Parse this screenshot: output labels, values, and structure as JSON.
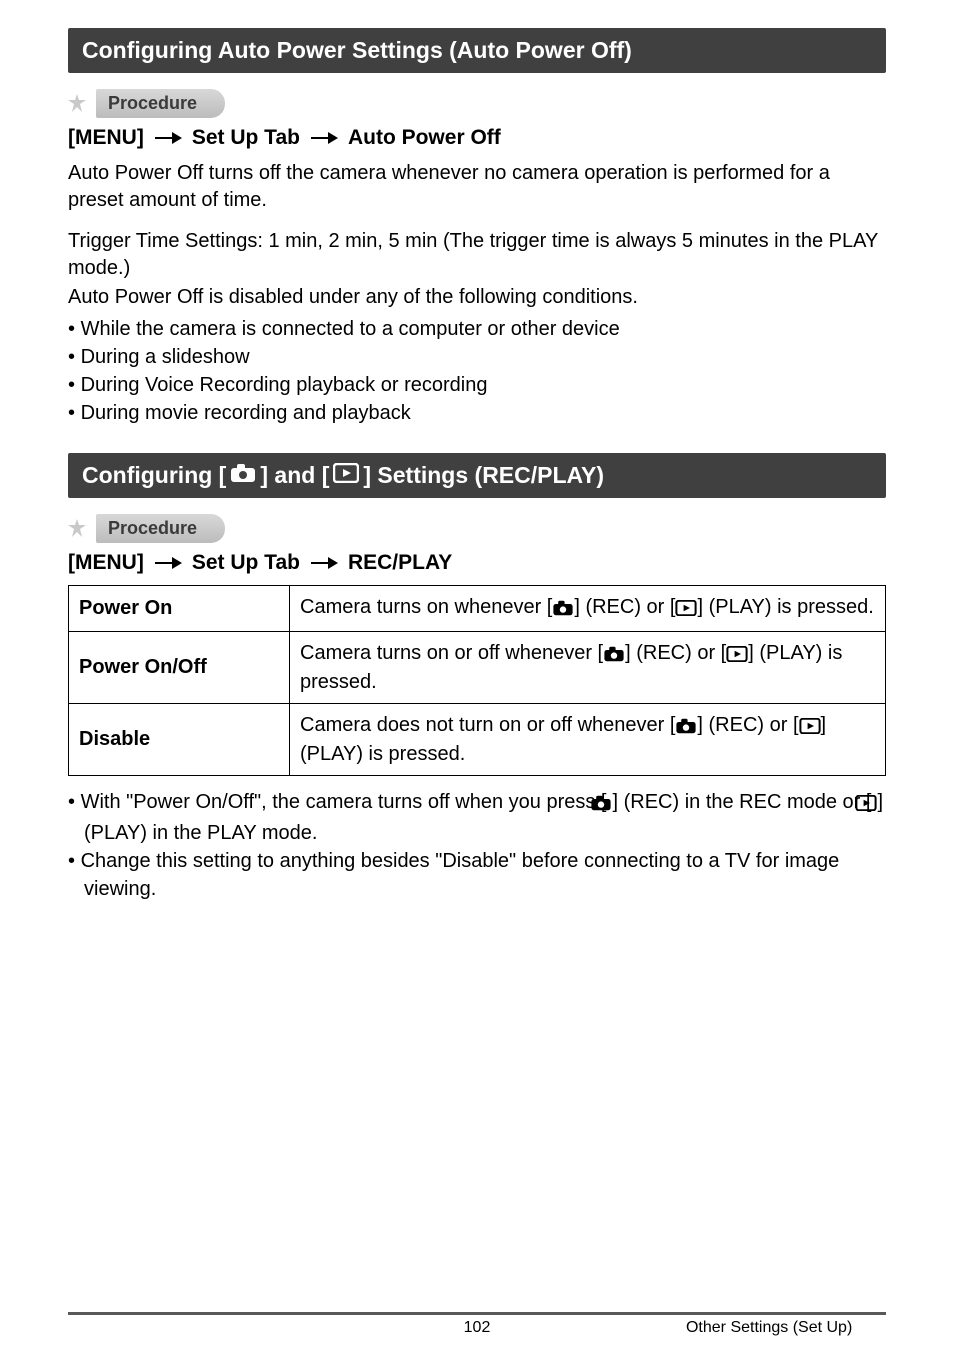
{
  "sections": {
    "autoPowerOff": {
      "title": "Configuring Auto Power Settings (Auto Power Off)",
      "procedure_label": "Procedure",
      "menu_path": {
        "a": "[MENU]",
        "b": "Set Up Tab",
        "c": "Auto Power Off"
      },
      "para1": "Auto Power Off turns off the camera whenever no camera operation is performed for a preset amount of time.",
      "para2": "Trigger Time Settings: 1 min, 2 min, 5 min (The trigger time is always 5 minutes in the PLAY mode.)",
      "para3": "Auto Power Off is disabled under any of the following conditions.",
      "bullets": [
        "While the camera is connected to a computer or other device",
        "During a slideshow",
        "During Voice Recording playback or recording",
        "During movie recording and playback"
      ]
    },
    "recPlay": {
      "title_parts": {
        "a": "Configuring [",
        "b": "] and [",
        "c": "] Settings (REC/PLAY)"
      },
      "procedure_label": "Procedure",
      "menu_path": {
        "a": "[MENU]",
        "b": "Set Up Tab",
        "c": "REC/PLAY"
      },
      "table": [
        {
          "label": "Power On",
          "pre": "Camera turns on whenever [",
          "mid1": "] (REC) or [",
          "mid2": "] (PLAY) is pressed."
        },
        {
          "label": "Power On/Off",
          "pre": "Camera turns on or off whenever [",
          "mid1": "] (REC) or [",
          "mid2": "] (PLAY) is pressed."
        },
        {
          "label": "Disable",
          "pre": "Camera does not turn on or off whenever [",
          "mid1": "] (REC) or [",
          "mid2": "] (PLAY) is pressed."
        }
      ],
      "bullets": [
        {
          "pre": "With \"Power On/Off\", the camera turns off when you press [",
          "mid1": "] (REC) in the REC mode or [",
          "mid2": "] (PLAY) in the PLAY mode."
        }
      ],
      "bullet_simple": "Change this setting to anything besides \"Disable\" before connecting to a TV for image viewing."
    }
  },
  "footer": {
    "page": "102",
    "label": "Other Settings (Set Up)"
  }
}
